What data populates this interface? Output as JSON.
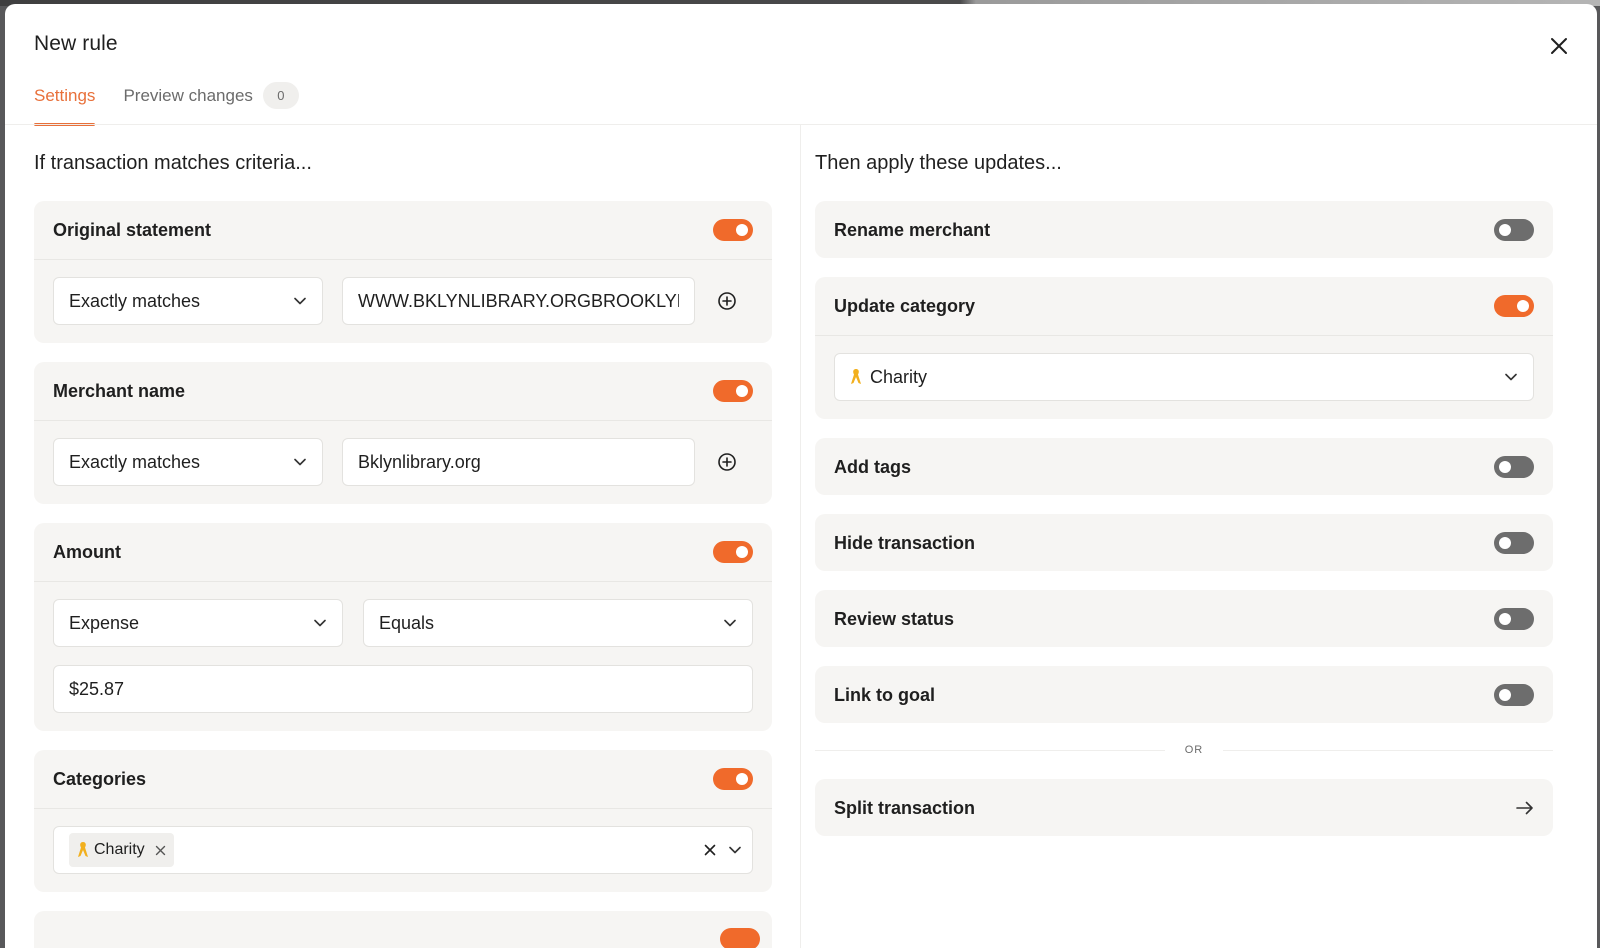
{
  "modal": {
    "title": "New rule",
    "tabs": [
      {
        "label": "Settings",
        "active": true
      },
      {
        "label": "Preview changes",
        "count": "0",
        "active": false
      }
    ]
  },
  "criteria": {
    "heading": "If transaction matches criteria...",
    "original_statement": {
      "label": "Original statement",
      "enabled": true,
      "operator": "Exactly matches",
      "value": "WWW.BKLYNLIBRARY.ORGBROOKLYN"
    },
    "merchant_name": {
      "label": "Merchant name",
      "enabled": true,
      "operator": "Exactly matches",
      "value": "Bklynlibrary.org"
    },
    "amount": {
      "label": "Amount",
      "enabled": true,
      "type": "Expense",
      "operator": "Equals",
      "value": "$25.87"
    },
    "categories": {
      "label": "Categories",
      "enabled": true,
      "selected": [
        {
          "label": "Charity",
          "icon": "ribbon-icon"
        }
      ]
    }
  },
  "updates": {
    "heading": "Then apply these updates...",
    "rename_merchant": {
      "label": "Rename merchant",
      "enabled": false
    },
    "update_category": {
      "label": "Update category",
      "enabled": true,
      "value": "Charity",
      "icon": "ribbon-icon"
    },
    "add_tags": {
      "label": "Add tags",
      "enabled": false
    },
    "hide_transaction": {
      "label": "Hide transaction",
      "enabled": false
    },
    "review_status": {
      "label": "Review status",
      "enabled": false
    },
    "link_to_goal": {
      "label": "Link to goal",
      "enabled": false
    },
    "or_label": "OR",
    "split_transaction": {
      "label": "Split transaction"
    }
  },
  "colors": {
    "accent": "#f06a2b",
    "tab_active": "#e8703a",
    "toggle_off": "#6d6d6d",
    "card_bg": "#f6f5f3",
    "ribbon": "#f2b01e"
  }
}
